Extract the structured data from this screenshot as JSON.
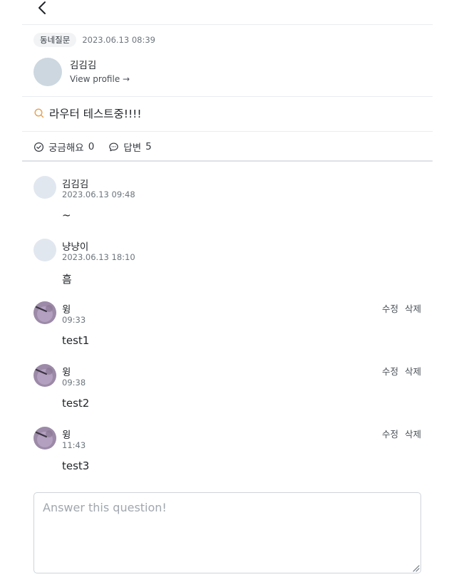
{
  "question": {
    "category": "동네질문",
    "posted_at": "2023.06.13 08:39",
    "author": {
      "name": "김김김",
      "view_profile_label": "View profile →"
    },
    "title": "라우터 테스트중!!!!",
    "stats": {
      "curious_label": "궁금해요",
      "curious_count": "0",
      "answers_label": "답변",
      "answers_count": "5"
    }
  },
  "answers": [
    {
      "name": "김김김",
      "time": "2023.06.13 09:48",
      "body": "~",
      "avatar": "blank"
    },
    {
      "name": "냥냥이",
      "time": "2023.06.13 18:10",
      "body": "흠",
      "avatar": "blank"
    },
    {
      "name": "윙",
      "time": "09:33",
      "body": "test1",
      "avatar": "photo",
      "edit_label": "수정",
      "delete_label": "삭제"
    },
    {
      "name": "윙",
      "time": "09:38",
      "body": "test2",
      "avatar": "photo",
      "edit_label": "수정",
      "delete_label": "삭제"
    },
    {
      "name": "윙",
      "time": "11:43",
      "body": "test3",
      "avatar": "photo",
      "edit_label": "수정",
      "delete_label": "삭제"
    }
  ],
  "composer": {
    "placeholder": "Answer this question!"
  },
  "colors": {
    "accent_search_icon": "#e8a04d",
    "divider": "#e9ecef",
    "avatar_placeholder": "#ccd7e0"
  },
  "icons": {
    "back": "chevron-left-icon",
    "question": "search-icon",
    "curious": "check-circle-icon",
    "answers": "chat-bubble-icon"
  }
}
